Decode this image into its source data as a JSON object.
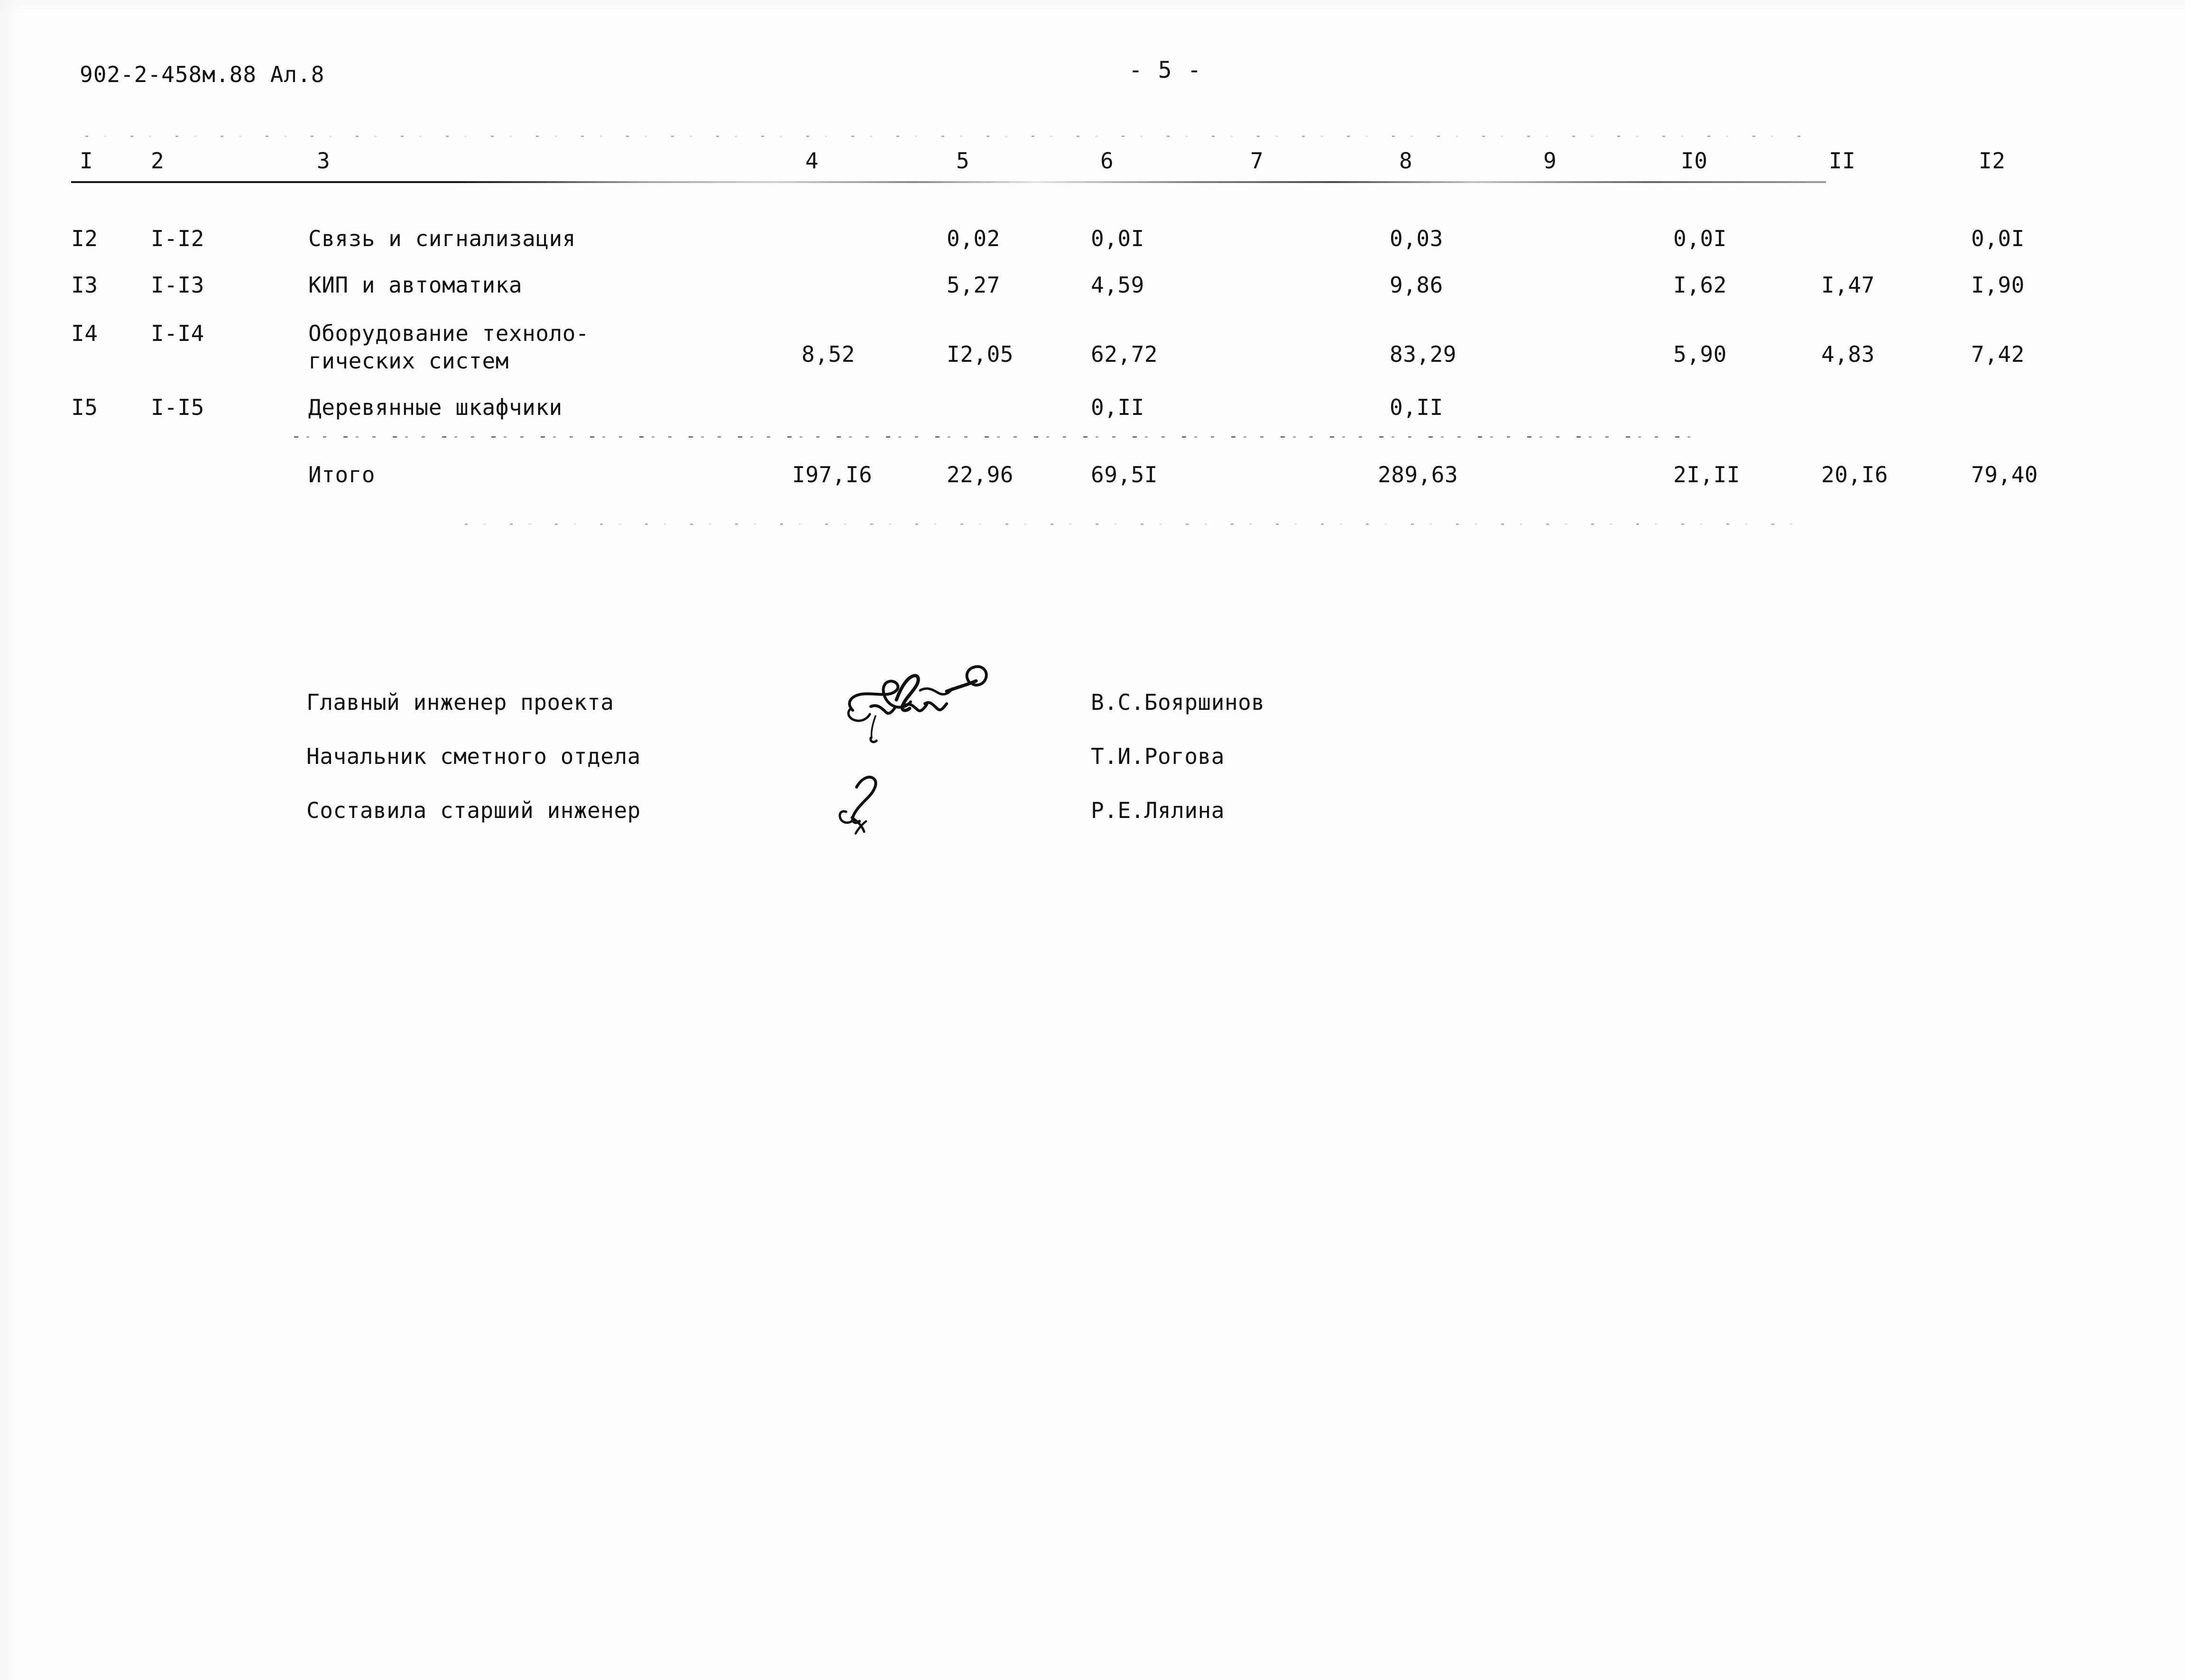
{
  "document": {
    "code": "902-2-458м.88 Ал.8",
    "page_number": "- 5 -"
  },
  "table": {
    "column_headers": [
      "I",
      "2",
      "3",
      "4",
      "5",
      "6",
      "7",
      "8",
      "9",
      "I0",
      "II",
      "I2"
    ],
    "rows": [
      {
        "c1": "I2",
        "c2": "I-I2",
        "c3": "Связь и сигнализация",
        "c4": "",
        "c5": "0,02",
        "c6": "0,0I",
        "c7": "",
        "c8": "0,03",
        "c9": "",
        "c10": "0,0I",
        "c11": "",
        "c12": "0,0I"
      },
      {
        "c1": "I3",
        "c2": "I-I3",
        "c3": "КИП и автоматика",
        "c4": "",
        "c5": "5,27",
        "c6": "4,59",
        "c7": "",
        "c8": "9,86",
        "c9": "",
        "c10": "I,62",
        "c11": "I,47",
        "c12": "I,90"
      },
      {
        "c1": "I4",
        "c2": "I-I4",
        "c3_line1": "Оборудование техноло-",
        "c3_line2": "гических систем",
        "c4": "8,52",
        "c5": "I2,05",
        "c6": "62,72",
        "c7": "",
        "c8": "83,29",
        "c9": "",
        "c10": "5,90",
        "c11": "4,83",
        "c12": "7,42"
      },
      {
        "c1": "I5",
        "c2": "I-I5",
        "c3": "Деревянные шкафчики",
        "c4": "",
        "c5": "",
        "c6": "0,II",
        "c7": "",
        "c8": "0,II",
        "c9": "",
        "c10": "",
        "c11": "",
        "c12": ""
      }
    ],
    "total_row": {
      "label": "Итого",
      "c4": "I97,I6",
      "c5": "22,96",
      "c6": "69,5I",
      "c7": "",
      "c8": "289,63",
      "c9": "",
      "c10": "2I,II",
      "c11": "20,I6",
      "c12": "79,40"
    }
  },
  "signatures": [
    {
      "title": "Главный инженер проекта",
      "name": "В.С.Бояршинов"
    },
    {
      "title": "Начальник сметного отдела",
      "name": "Т.И.Рогова"
    },
    {
      "title": "Составила старший инженер",
      "name": "Р.Е.Лялина"
    }
  ]
}
